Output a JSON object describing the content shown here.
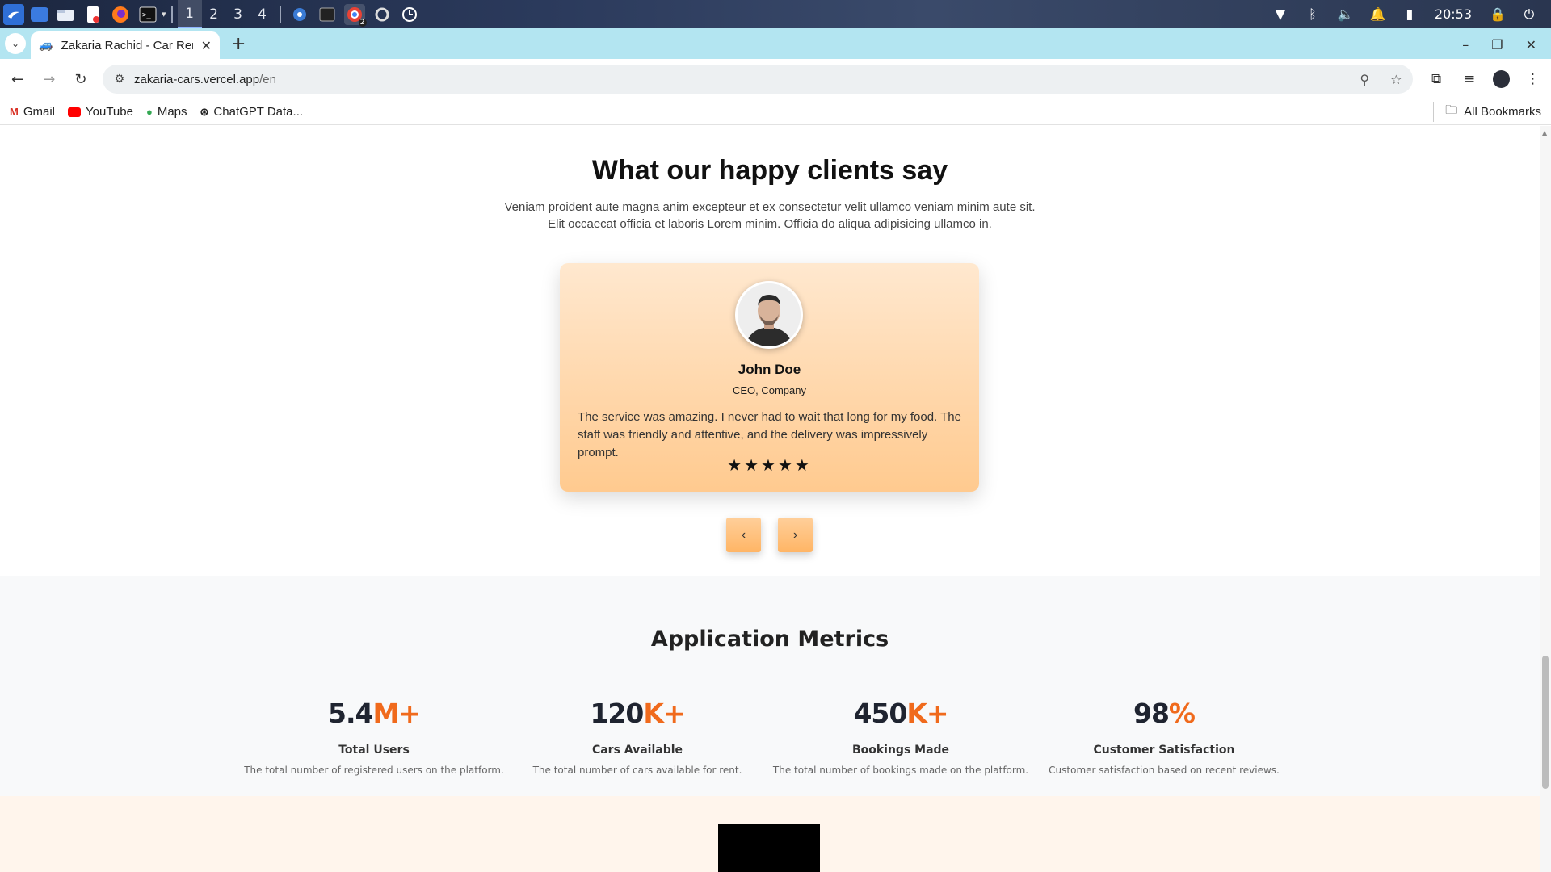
{
  "os": {
    "workspaces": [
      "1",
      "2",
      "3",
      "4"
    ],
    "clock": "20:53",
    "badge_count": "2"
  },
  "browser": {
    "tab_title": "Zakaria Rachid - Car Rent",
    "url_host": "zakaria-cars.vercel.app",
    "url_path": "/en",
    "bookmarks": [
      "Gmail",
      "YouTube",
      "Maps",
      "ChatGPT Data..."
    ],
    "all_bookmarks": "All Bookmarks"
  },
  "testimonials": {
    "heading": "What our happy clients say",
    "subtitle": "Veniam proident aute magna anim excepteur et ex consectetur velit ullamco veniam minim aute sit. Elit occaecat officia et laboris Lorem minim. Officia do aliqua adipisicing ullamco in.",
    "card": {
      "name": "John Doe",
      "role": "CEO, Company",
      "quote": "The service was amazing. I never had to wait that long for my food. The staff was friendly and attentive, and the delivery was impressively prompt.",
      "rating": 5,
      "stars": "★★★★★"
    },
    "prev_label": "‹",
    "next_label": "›"
  },
  "metrics": {
    "heading": "Application Metrics",
    "items": [
      {
        "number": "5.4",
        "suffix": "M+",
        "label": "Total Users",
        "desc": "The total number of registered users on the platform."
      },
      {
        "number": "120",
        "suffix": "K+",
        "label": "Cars Available",
        "desc": "The total number of cars available for rent."
      },
      {
        "number": "450",
        "suffix": "K+",
        "label": "Bookings Made",
        "desc": "The total number of bookings made on the platform."
      },
      {
        "number": "98",
        "suffix": "%",
        "label": "Customer Satisfaction",
        "desc": "Customer satisfaction based on recent reviews."
      }
    ]
  },
  "colors": {
    "accent_orange": "#f06a1c",
    "card_top": "#ffe8cf",
    "card_bottom": "#ffca8f",
    "tabstrip": "#b3e5f1"
  }
}
